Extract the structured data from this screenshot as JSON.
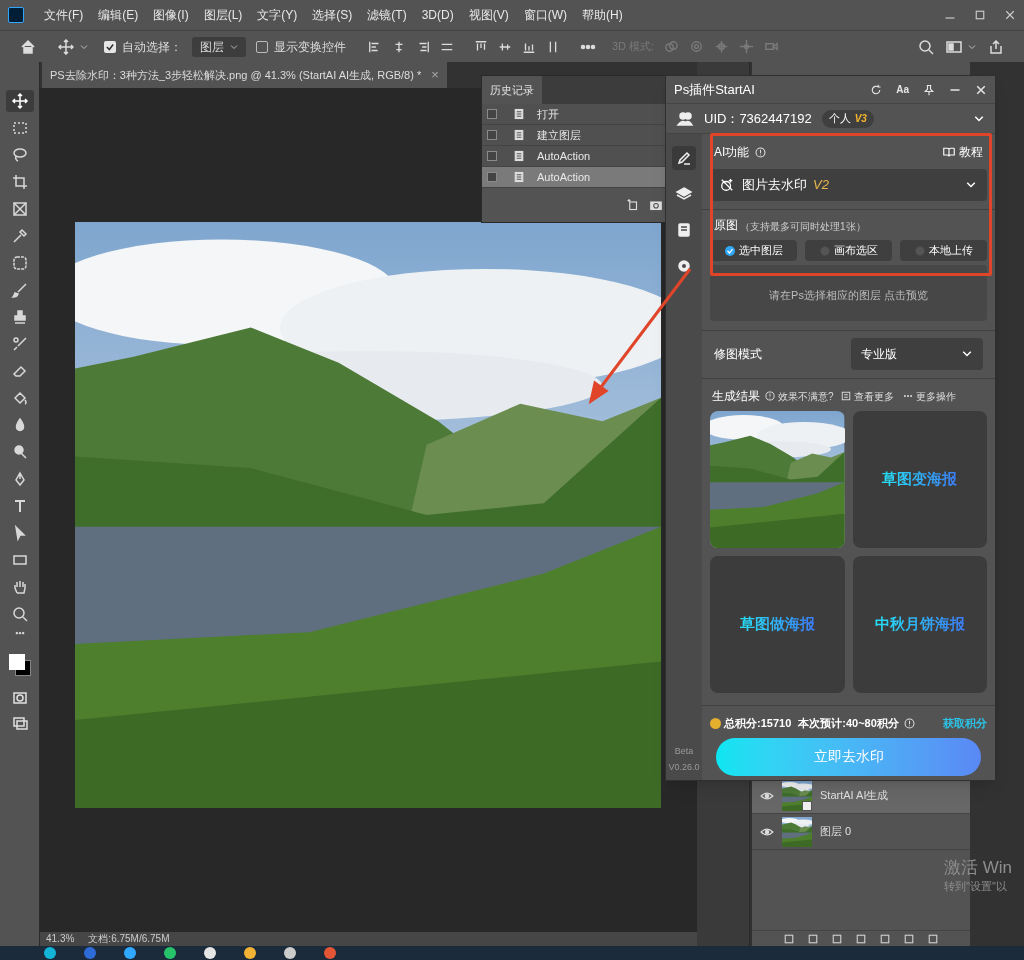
{
  "menu_bar": {
    "items": [
      "文件(F)",
      "编辑(E)",
      "图像(I)",
      "图层(L)",
      "文字(Y)",
      "选择(S)",
      "滤镜(T)",
      "3D(D)",
      "视图(V)",
      "窗口(W)",
      "帮助(H)"
    ]
  },
  "options_bar": {
    "auto_select": {
      "label": "自动选择：",
      "checked": true
    },
    "auto_select_target": "图层",
    "transform_controls": {
      "label": "显示变换控件",
      "checked": false
    },
    "mode_3d_label": "3D 模式:"
  },
  "tools": [
    {
      "selected": true
    },
    {
      "selected": false
    },
    {
      "selected": false
    },
    {
      "selected": false
    },
    {
      "selected": false
    },
    {
      "selected": false
    },
    {
      "selected": false
    },
    {
      "selected": false
    },
    {
      "selected": false
    },
    {
      "selected": false
    },
    {
      "selected": false
    },
    {
      "selected": false
    },
    {
      "selected": false
    },
    {
      "selected": false
    },
    {
      "selected": false
    },
    {
      "selected": false
    },
    {
      "selected": false
    },
    {
      "selected": false
    },
    {
      "selected": false
    },
    {
      "selected": false
    }
  ],
  "document_tab": {
    "title": "PS去除水印：3种方法_3步轻松解决.png @ 41.3% (StartAI AI生成, RGB/8) *",
    "close": "×"
  },
  "history_panel": {
    "title": "历史记录",
    "items": [
      {
        "label": "打开",
        "selected": false
      },
      {
        "label": "建立图层",
        "selected": false
      },
      {
        "label": "AutoAction",
        "selected": false
      },
      {
        "label": "AutoAction",
        "selected": true
      }
    ]
  },
  "plugin": {
    "title": "Ps插件StartAI",
    "font_button": "Aa",
    "uid": "UID：7362447192",
    "plan": "个人",
    "plan_version": "V3",
    "rail": [
      {
        "selected": true
      },
      {
        "selected": false
      },
      {
        "selected": false
      },
      {
        "selected": false
      }
    ],
    "ai_function": {
      "label": "AI功能",
      "tutorial": "教程",
      "value": "图片去水印",
      "version": "V2"
    },
    "source": {
      "label": "原图",
      "hint": "（支持最多可同时处理1张）",
      "options": [
        {
          "label": "选中图层",
          "selected": true
        },
        {
          "label": "画布选区",
          "selected": false
        },
        {
          "label": "本地上传",
          "selected": false
        }
      ]
    },
    "preview_hint": "请在Ps选择相应的图层 点击预览",
    "mode": {
      "label": "修图模式",
      "value": "专业版"
    },
    "results": {
      "label": "生成结果",
      "unsatisfied": "效果不满意?",
      "view_more": "查看更多",
      "more_actions": "更多操作",
      "cards": [
        {
          "kind": "photo"
        },
        {
          "kind": "poster",
          "label": "草图变海报"
        },
        {
          "kind": "poster",
          "label": "草图做海报"
        },
        {
          "kind": "poster",
          "label": "中秋月饼海报"
        }
      ]
    },
    "points": {
      "total": "总积分:15710",
      "estimate": "本次预计:40~80积分",
      "get_points": "获取积分"
    },
    "action_button": "立即去水印",
    "beta": "Beta",
    "version": "V0.26.0"
  },
  "layers": [
    {
      "name": "StartAI AI生成",
      "selected": true,
      "smart_object": true
    },
    {
      "name": "图层 0",
      "selected": false,
      "smart_object": false
    }
  ],
  "activation_notice": {
    "title": "激活 Win",
    "body": "转到\"设置\"以"
  },
  "status_bar": {
    "zoom": "41.3%",
    "document": "文档:6.75M/6.75M"
  }
}
